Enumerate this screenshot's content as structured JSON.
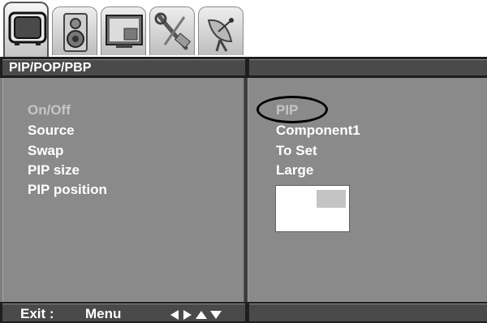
{
  "tabs": [
    {
      "icon": "tv-icon",
      "active": true
    },
    {
      "icon": "speaker-icon",
      "active": false
    },
    {
      "icon": "pip-screen-icon",
      "active": false
    },
    {
      "icon": "tools-icon",
      "active": false
    },
    {
      "icon": "satellite-dish-icon",
      "active": false
    }
  ],
  "header": {
    "title": "PIP/POP/PBP"
  },
  "menu": {
    "items": [
      {
        "label": "On/Off",
        "highlighted": true
      },
      {
        "label": "Source",
        "highlighted": false
      },
      {
        "label": "Swap",
        "highlighted": false
      },
      {
        "label": "PIP size",
        "highlighted": false
      },
      {
        "label": "PIP position",
        "highlighted": false
      }
    ]
  },
  "values": {
    "items": [
      {
        "label": "PIP",
        "highlighted": true
      },
      {
        "label": "Component1",
        "highlighted": false
      },
      {
        "label": "To Set",
        "highlighted": false
      },
      {
        "label": "Large",
        "highlighted": false
      }
    ]
  },
  "footer": {
    "exit_label": "Exit :",
    "menu_label": "Menu",
    "arrows": [
      "left-arrow-icon",
      "right-arrow-icon",
      "up-arrow-icon",
      "down-arrow-icon"
    ]
  },
  "colors": {
    "panel": "#8a8a8a",
    "bar": "#1e1e1e",
    "highlight_text": "#c6c6c6",
    "text": "#ffffff"
  }
}
